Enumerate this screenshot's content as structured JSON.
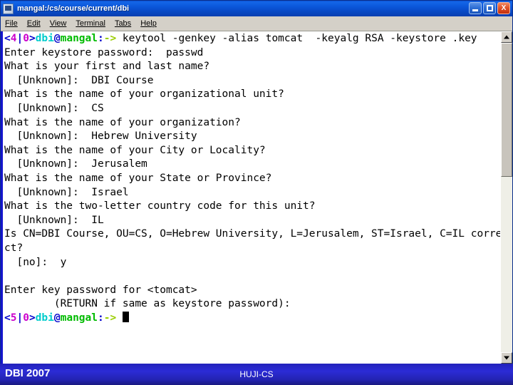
{
  "window": {
    "title": "mangal:/cs/course/current/dbi",
    "icon": "terminal-icon",
    "controls": {
      "minimize": "minimize-button",
      "maximize": "maximize-button",
      "close_label": "X"
    },
    "menu": [
      {
        "label": "File",
        "accel": "F"
      },
      {
        "label": "Edit",
        "accel": "E"
      },
      {
        "label": "View",
        "accel": "V"
      },
      {
        "label": "Terminal",
        "accel": "T"
      },
      {
        "label": "Tabs",
        "accel": "T"
      },
      {
        "label": "Help",
        "accel": "H"
      }
    ]
  },
  "terminal": {
    "prompt1": {
      "lt": "<",
      "job": "4",
      "bar": "|",
      "status": "0",
      "gt": ">",
      "user": "dbi",
      "at": "@",
      "host": "mangal",
      "colon": ":",
      "arrow": "->"
    },
    "prompt2": {
      "lt": "<",
      "job": "5",
      "bar": "|",
      "status": "0",
      "gt": ">",
      "user": "dbi",
      "at": "@",
      "host": "mangal",
      "colon": ":",
      "arrow": "->"
    },
    "command": " keytool -genkey -alias tomcat  -keyalg RSA -keystore .key",
    "lines": [
      "Enter keystore password:  passwd",
      "What is your first and last name?",
      "  [Unknown]:  DBI Course",
      "What is the name of your organizational unit?",
      "  [Unknown]:  CS",
      "What is the name of your organization?",
      "  [Unknown]:  Hebrew University",
      "What is the name of your City or Locality?",
      "  [Unknown]:  Jerusalem",
      "What is the name of your State or Province?",
      "  [Unknown]:  Israel",
      "What is the two-letter country code for this unit?",
      "  [Unknown]:  IL",
      "Is CN=DBI Course, OU=CS, O=Hebrew University, L=Jerusalem, ST=Israel, C=IL corre",
      "ct?",
      "  [no]:  y",
      "",
      "Enter key password for <tomcat>",
      "        (RETURN if same as keystore password):"
    ]
  },
  "footer": {
    "left": "DBI 2007",
    "center": "HUJI-CS"
  },
  "colors": {
    "titlebar": "#0a55d8",
    "footer": "#2323b2",
    "terminal_bg": "#ffffff",
    "prompt_blue": "#0000cc",
    "prompt_magenta": "#cc00cc",
    "prompt_cyan": "#00cccc",
    "prompt_green": "#00bb00",
    "prompt_arrow": "#9acd00"
  }
}
